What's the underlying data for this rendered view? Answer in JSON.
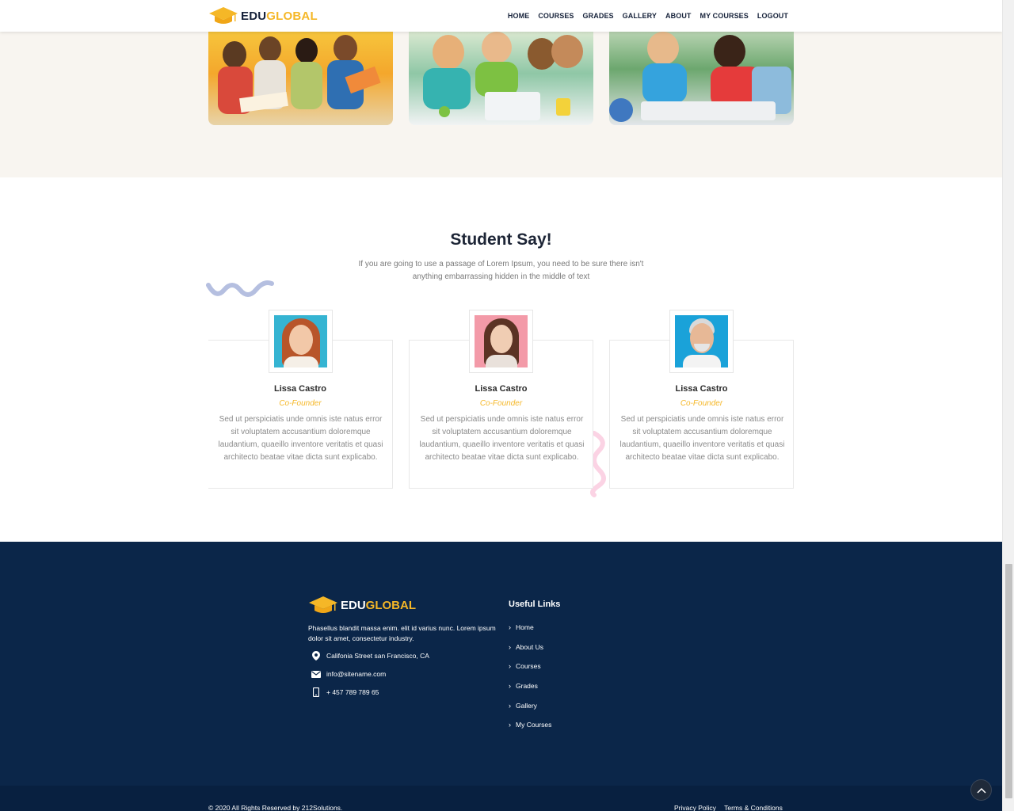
{
  "header": {
    "logo_part1": "EDU",
    "logo_part2": "GLOBAL",
    "nav": [
      "HOME",
      "COURSES",
      "GRADES",
      "GALLERY",
      "ABOUT",
      "MY COURSES",
      "LOGOUT"
    ]
  },
  "colors": {
    "accent": "#f5b727",
    "navy": "#0b2649",
    "heading": "#1d2536",
    "section_bg": "#f8f5f0"
  },
  "testimonials": {
    "title": "Student Say!",
    "description": "If you are going to use a passage of Lorem Ipsum, you need to be sure there isn't anything embarrassing hidden in the middle of text",
    "cards": [
      {
        "name": "Lissa Castro",
        "role": "Co-Founder",
        "text": "Sed ut perspiciatis unde omnis iste natus error sit voluptatem accusantium doloremque laudantium, quaeillo inventore veritatis et quasi architecto beatae vitae dicta sunt explicabo."
      },
      {
        "name": "Lissa Castro",
        "role": "Co-Founder",
        "text": "Sed ut perspiciatis unde omnis iste natus error sit voluptatem accusantium doloremque laudantium, quaeillo inventore veritatis et quasi architecto beatae vitae dicta sunt explicabo."
      },
      {
        "name": "Lissa Castro",
        "role": "Co-Founder",
        "text": "Sed ut perspiciatis unde omnis iste natus error sit voluptatem accusantium doloremque laudantium, quaeillo inventore veritatis et quasi architecto beatae vitae dicta sunt explicabo."
      }
    ]
  },
  "footer": {
    "logo_part1": "EDU",
    "logo_part2": "GLOBAL",
    "description": "Phasellus blandit massa enim. elit id varius nunc. Lorem ipsum dolor sit amet, consectetur industry.",
    "address": "Califonia Street san Francisco, CA",
    "email": "info@sitename.com",
    "phone": "+ 457 789 789 65",
    "useful_title": "Useful Links",
    "useful_links": [
      "Home",
      "About Us",
      "Courses",
      "Grades",
      "Gallery",
      "My Courses"
    ],
    "copyright": "© 2020 All Rights Reserved by 212Solutions.",
    "privacy": "Privacy Policy",
    "terms": "Terms & Conditions"
  }
}
